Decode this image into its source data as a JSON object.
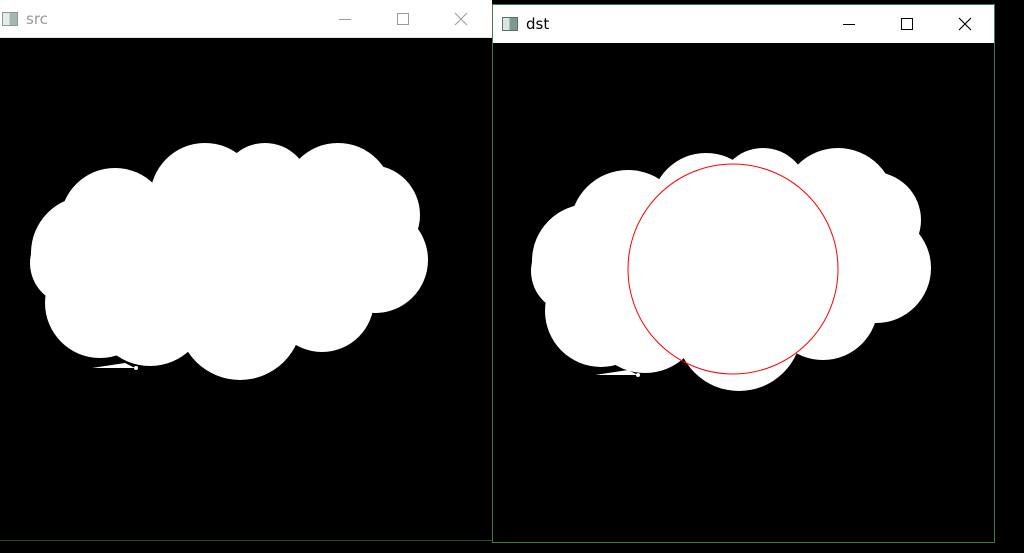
{
  "windows": {
    "src": {
      "title": "src",
      "controls": [
        "minimize-icon",
        "maximize-icon",
        "close-icon"
      ]
    },
    "dst": {
      "title": "dst",
      "controls": [
        "minimize-icon",
        "maximize-icon",
        "close-icon"
      ]
    }
  },
  "colors": {
    "background": "#000000",
    "shape_fill": "#ffffff",
    "circle_stroke": "#ff0000",
    "active_border": "#3f7a46"
  }
}
